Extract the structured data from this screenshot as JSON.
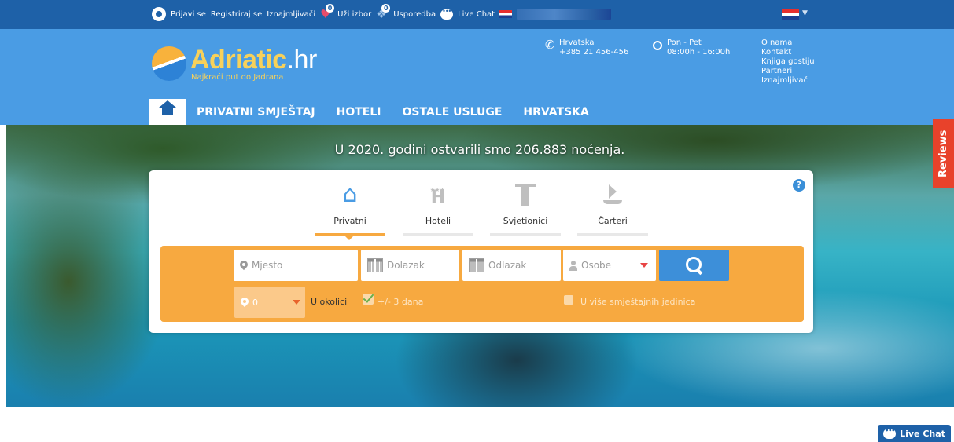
{
  "topbar": {
    "login": "Prijavi se",
    "register": "Registriraj se",
    "renters": "Iznajmljivači",
    "shortlist_count": "0",
    "shortlist": "Uži izbor",
    "compare_count": "0",
    "compare": "Usporedba",
    "live_chat": "Live Chat"
  },
  "header": {
    "logo_main": "Adriatic",
    "logo_tld": ".hr",
    "tagline": "Najkraći put do Jadrana",
    "region": "Hrvatska",
    "phone": "+385 21 456-456",
    "days": "Pon - Pet",
    "hours": "08:00h - 16:00h",
    "links": [
      "O nama",
      "Kontakt",
      "Knjiga gostiju",
      "Partneri",
      "Iznajmljivači"
    ]
  },
  "nav": {
    "items": [
      "PRIVATNI SMJEŠTAJ",
      "HOTELI",
      "OSTALE USLUGE",
      "HRVATSKA"
    ]
  },
  "hero": {
    "title": "U 2020. godini ostvarili smo 206.883 noćenja.",
    "reviews": "Reviews"
  },
  "search": {
    "tabs": [
      "Privatni",
      "Hoteli",
      "Svjetionici",
      "Čarteri"
    ],
    "active_tab": "Privatni",
    "place_placeholder": "Mjesto",
    "arrival_placeholder": "Dolazak",
    "departure_placeholder": "Odlazak",
    "guests_placeholder": "Osobe",
    "radius_value": "0",
    "nearby_label": "U okolici",
    "flex_dates_label": "+/- 3 dana",
    "multi_unit_label": "U više smještajnih jedinica"
  },
  "footer": {
    "live_chat": "Live Chat"
  },
  "colors": {
    "topbar": "#1e61a8",
    "header": "#4a9ce4",
    "search_orange": "#f7a940",
    "search_button": "#3d8fd9",
    "reviews_red": "#e8422b"
  },
  "icons": [
    "user-icon",
    "heart-icon",
    "compare-icon",
    "chat-icon",
    "flag-icon",
    "phone-icon",
    "clock-icon",
    "home-icon",
    "help-icon",
    "house-icon",
    "hotel-icon",
    "lighthouse-icon",
    "boat-icon",
    "pin-icon",
    "calendar-icon",
    "person-icon",
    "search-icon",
    "check-icon"
  ]
}
